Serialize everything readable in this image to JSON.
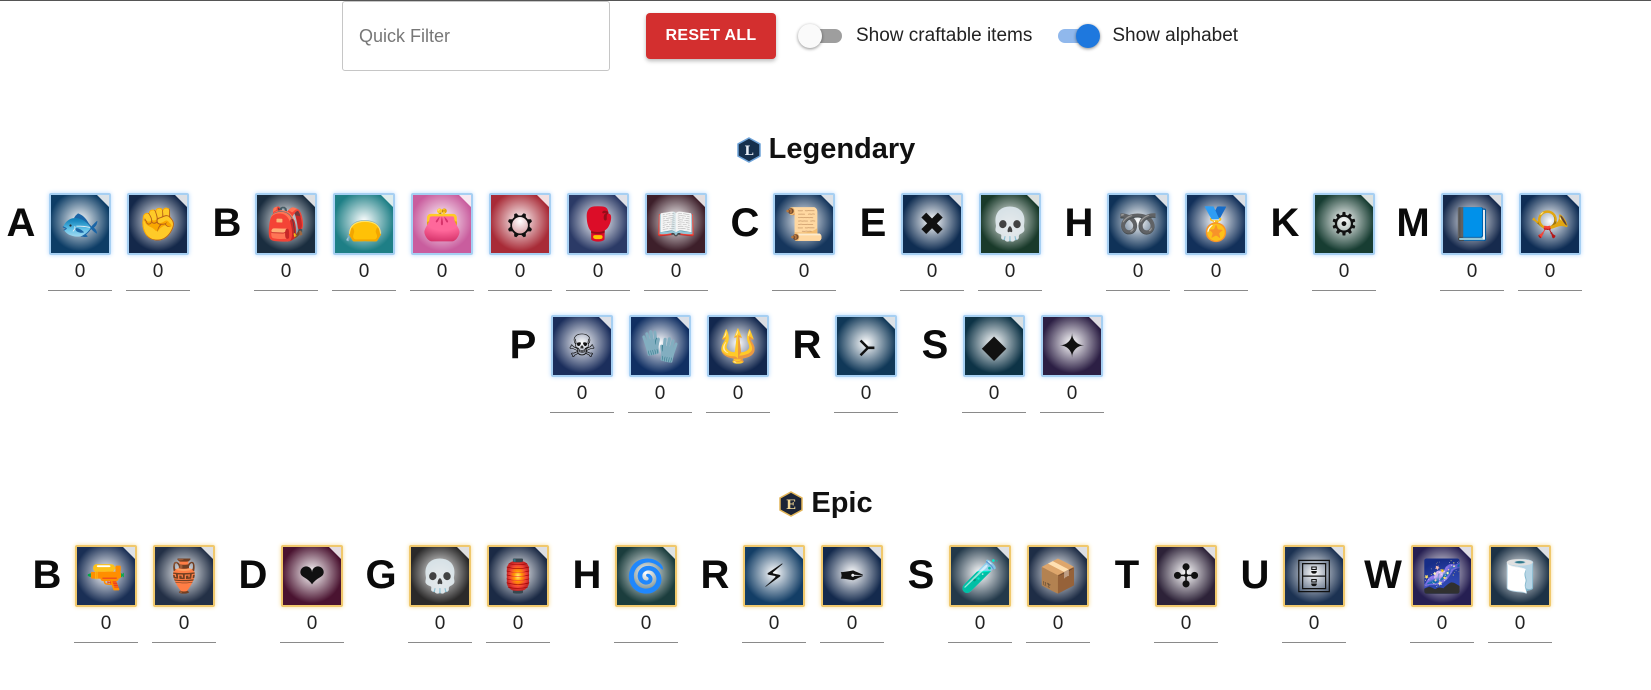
{
  "toolbar": {
    "search_placeholder": "Quick Filter",
    "reset_label": "RESET ALL",
    "craftable_label": "Show craftable items",
    "craftable_on": false,
    "alphabet_label": "Show alphabet",
    "alphabet_on": true
  },
  "sections": [
    {
      "title": "Legendary",
      "badge": "L",
      "rarity": "legendary",
      "groups": [
        {
          "letter": "A",
          "items": [
            {
              "icon": "fish-icon",
              "glyph": "🐟",
              "bg": "#0d3d66",
              "count": "0"
            },
            {
              "icon": "gauntlet-icon",
              "glyph": "✊",
              "bg": "#14284a",
              "count": "0"
            }
          ]
        },
        {
          "letter": "B",
          "items": [
            {
              "icon": "backpack-icon",
              "glyph": "🎒",
              "bg": "#1a2d3f",
              "count": "0"
            },
            {
              "icon": "bag-icon",
              "glyph": "👝",
              "bg": "#1e7f86",
              "count": "0"
            },
            {
              "icon": "bag-icon",
              "glyph": "👛",
              "bg": "#c95d9e",
              "count": "0"
            },
            {
              "icon": "bag-icon",
              "glyph": "⛭",
              "bg": "#a82b37",
              "count": "0"
            },
            {
              "icon": "bracers-icon",
              "glyph": "🥊",
              "bg": "#2b3a66",
              "count": "0"
            },
            {
              "icon": "book-icon",
              "glyph": "📖",
              "bg": "#3d1f2a",
              "count": "0"
            }
          ]
        },
        {
          "letter": "C",
          "items": [
            {
              "icon": "scroll-icon",
              "glyph": "📜",
              "bg": "#15365d",
              "count": "0"
            }
          ]
        },
        {
          "letter": "E",
          "items": [
            {
              "icon": "crossbow-icon",
              "glyph": "✖",
              "bg": "#0f2d52",
              "count": "0"
            },
            {
              "icon": "skull-gem-icon",
              "glyph": "💀",
              "bg": "#193a2a",
              "count": "0"
            }
          ]
        },
        {
          "letter": "H",
          "items": [
            {
              "icon": "horseshoe-icon",
              "glyph": "➿",
              "bg": "#0f3258",
              "count": "0"
            },
            {
              "icon": "medal-icon",
              "glyph": "🏅",
              "bg": "#12305a",
              "count": "0"
            }
          ]
        },
        {
          "letter": "K",
          "items": [
            {
              "icon": "gear-icon",
              "glyph": "⚙",
              "bg": "#173d32",
              "count": "0"
            }
          ]
        },
        {
          "letter": "M",
          "items": [
            {
              "icon": "tome-icon",
              "glyph": "📘",
              "bg": "#162a4d",
              "count": "0"
            },
            {
              "icon": "horn-icon",
              "glyph": "📯",
              "bg": "#0e2d55",
              "count": "0"
            }
          ]
        },
        {
          "letter": "P",
          "items": [
            {
              "icon": "skull-staff-icon",
              "glyph": "☠",
              "bg": "#1b2e5c",
              "count": "0"
            },
            {
              "icon": "glove-icon",
              "glyph": "🧤",
              "bg": "#102f63",
              "count": "0"
            },
            {
              "icon": "torch-icon",
              "glyph": "🔱",
              "bg": "#12274e",
              "count": "0"
            }
          ]
        },
        {
          "letter": "R",
          "items": [
            {
              "icon": "rune-icon",
              "glyph": "᚛",
              "bg": "#103858",
              "count": "0"
            }
          ]
        },
        {
          "letter": "S",
          "items": [
            {
              "icon": "shard-icon",
              "glyph": "◆",
              "bg": "#0d3346",
              "count": "0"
            },
            {
              "icon": "stone-icon",
              "glyph": "✦",
              "bg": "#2c1f44",
              "count": "0"
            }
          ]
        }
      ]
    },
    {
      "title": "Epic",
      "badge": "E",
      "rarity": "epic",
      "groups": [
        {
          "letter": "B",
          "items": [
            {
              "icon": "blaster-icon",
              "glyph": "🔫",
              "bg": "#1a2f55",
              "count": "0"
            },
            {
              "icon": "gourd-icon",
              "glyph": "🏺",
              "bg": "#233046",
              "count": "0"
            }
          ]
        },
        {
          "letter": "D",
          "items": [
            {
              "icon": "heart-icon",
              "glyph": "❤",
              "bg": "#4a1330",
              "count": "0"
            }
          ]
        },
        {
          "letter": "G",
          "items": [
            {
              "icon": "skull-icon",
              "glyph": "💀",
              "bg": "#2b2a2a",
              "count": "0"
            },
            {
              "icon": "lantern-icon",
              "glyph": "🏮",
              "bg": "#1b2a45",
              "count": "0"
            }
          ]
        },
        {
          "letter": "H",
          "items": [
            {
              "icon": "orb-icon",
              "glyph": "🌀",
              "bg": "#1b3d3d",
              "count": "0"
            }
          ]
        },
        {
          "letter": "R",
          "items": [
            {
              "icon": "lightning-icon",
              "glyph": "⚡",
              "bg": "#133e66",
              "count": "0"
            },
            {
              "icon": "pen-icon",
              "glyph": "✒",
              "bg": "#142a4d",
              "count": "0"
            }
          ]
        },
        {
          "letter": "S",
          "items": [
            {
              "icon": "chest-icon",
              "glyph": "🧪",
              "bg": "#23394a",
              "count": "0"
            },
            {
              "icon": "box-icon",
              "glyph": "📦",
              "bg": "#1e2d46",
              "count": "0"
            }
          ]
        },
        {
          "letter": "T",
          "items": [
            {
              "icon": "emblem-icon",
              "glyph": "✣",
              "bg": "#2d2238",
              "count": "0"
            }
          ]
        },
        {
          "letter": "U",
          "items": [
            {
              "icon": "crate-icon",
              "glyph": "🗄",
              "bg": "#1c3252",
              "count": "0"
            }
          ]
        },
        {
          "letter": "W",
          "items": [
            {
              "icon": "vortex-icon",
              "glyph": "🌌",
              "bg": "#261f52",
              "count": "0"
            },
            {
              "icon": "cloth-icon",
              "glyph": "🧻",
              "bg": "#1d3246",
              "count": "0"
            }
          ]
        }
      ]
    }
  ],
  "colors": {
    "reset": "#d32f2f",
    "toggle_on": "#1e78de",
    "legendary_border": "#a6cff2",
    "epic_border": "#f0c86c"
  }
}
